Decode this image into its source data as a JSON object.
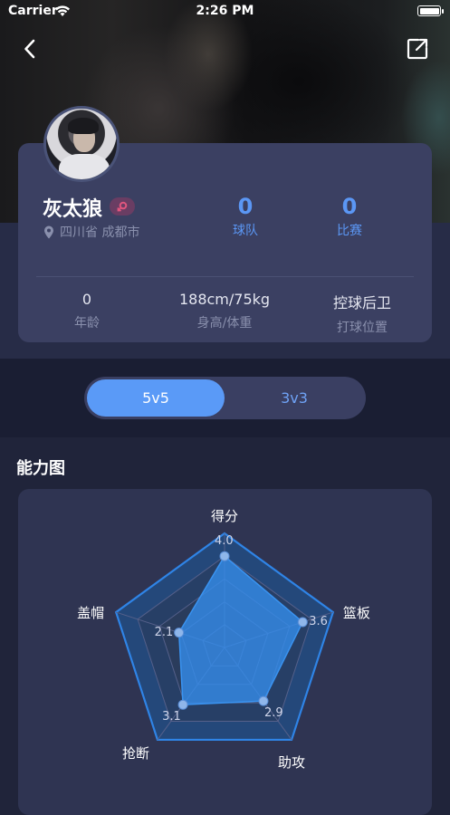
{
  "status_bar": {
    "carrier": "Carrier",
    "time": "2:26 PM"
  },
  "nav": {
    "back_icon": "chevron-left-icon",
    "share_icon": "share-icon"
  },
  "profile": {
    "name": "灰太狼",
    "gender_icon": "female-icon",
    "gender_color": "#e0567e",
    "location_icon": "location-pin-icon",
    "location": "四川省 成都市",
    "stats": [
      {
        "value": "0",
        "label": "球队"
      },
      {
        "value": "0",
        "label": "比赛"
      }
    ],
    "info": [
      {
        "value": "0",
        "label": "年龄"
      },
      {
        "value": "188cm/75kg",
        "label": "身高/体重"
      },
      {
        "value": "控球后卫",
        "label": "打球位置"
      }
    ]
  },
  "tabs": [
    {
      "label": "5v5",
      "active": true
    },
    {
      "label": "3v3",
      "active": false
    }
  ],
  "ability": {
    "title": "能力图",
    "axes": [
      "得分",
      "篮板",
      "助攻",
      "抢断",
      "盖帽"
    ],
    "values": [
      4.0,
      3.6,
      2.9,
      3.1,
      2.1
    ],
    "value_labels": [
      "4.0",
      "3.6",
      "2.9",
      "3.1",
      "2.1"
    ],
    "max": 5,
    "accent": "#2f84e6"
  },
  "colors": {
    "accent": "#5a9af7",
    "card": "#3b4062",
    "background": "#20243a"
  }
}
